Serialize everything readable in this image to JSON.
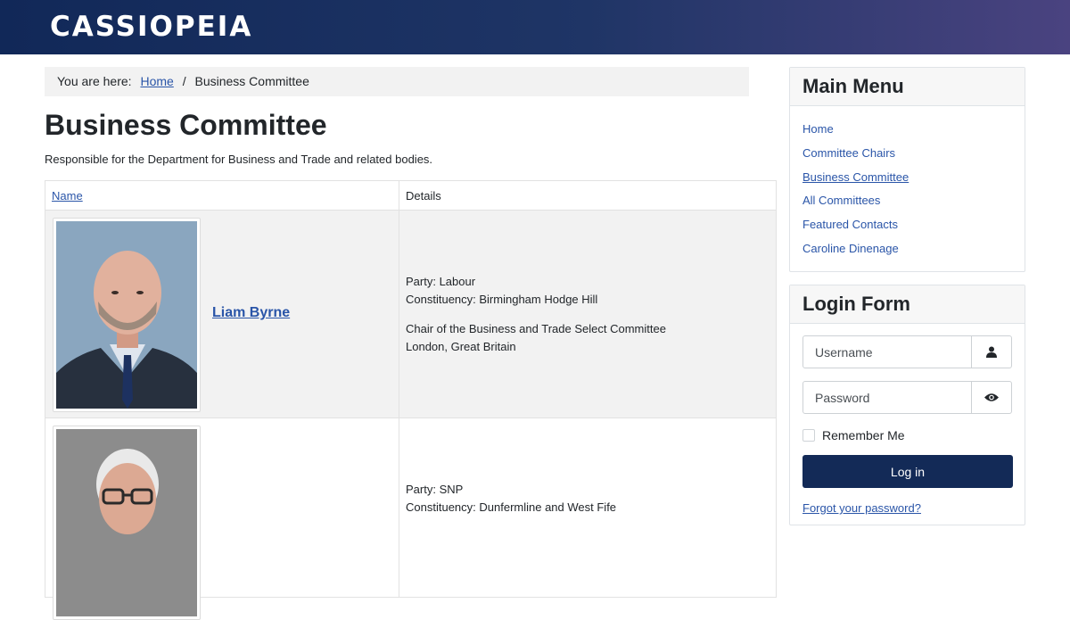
{
  "site": {
    "brand": "CASSIOPEIA"
  },
  "breadcrumb": {
    "prefix": "You are here:",
    "home": "Home",
    "separator": "/",
    "current": "Business Committee"
  },
  "page": {
    "title": "Business Committee",
    "description": "Responsible for the Department for Business and Trade and related bodies."
  },
  "table": {
    "headers": {
      "name": "Name",
      "details": "Details"
    },
    "rows": [
      {
        "name": "Liam Byrne",
        "party": "Party: Labour",
        "constituency": "Constituency: Birmingham Hodge Hill",
        "position": "Chair of the Business and Trade Select Committee",
        "location": "London, Great Britain"
      },
      {
        "name": "",
        "party": "Party: SNP",
        "constituency": "Constituency: Dunfermline and West Fife"
      }
    ]
  },
  "main_menu": {
    "title": "Main Menu",
    "items": [
      {
        "label": "Home"
      },
      {
        "label": "Committee Chairs"
      },
      {
        "label": "Business Committee"
      },
      {
        "label": "All Committees"
      },
      {
        "label": "Featured Contacts"
      },
      {
        "label": "Caroline Dinenage"
      }
    ]
  },
  "login_form": {
    "title": "Login Form",
    "username_placeholder": "Username",
    "password_placeholder": "Password",
    "remember_label": "Remember Me",
    "login_label": "Log in",
    "forgot_label": "Forgot your password?",
    "user_icon": "user-icon",
    "password_icon": "eye-icon"
  },
  "colors": {
    "header_start": "#112858",
    "header_end": "#4a4380",
    "link": "#2a55a8",
    "button": "#132a57"
  }
}
